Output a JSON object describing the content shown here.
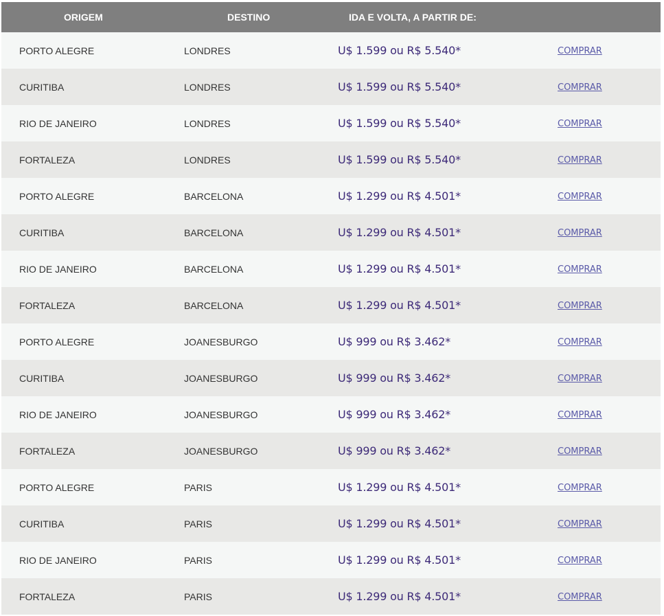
{
  "table": {
    "headers": {
      "origin": "ORIGEM",
      "destination": "DESTINO",
      "price": "IDA E VOLTA, A PARTIR DE:",
      "action": ""
    },
    "rows": [
      {
        "origin": "PORTO ALEGRE",
        "destination": "LONDRES",
        "price": "U$ 1.599 ou R$ 5.540*",
        "action": "COMPRAR"
      },
      {
        "origin": "CURITIBA",
        "destination": "LONDRES",
        "price": "U$ 1.599 ou R$ 5.540*",
        "action": "COMPRAR"
      },
      {
        "origin": "RIO DE JANEIRO",
        "destination": "LONDRES",
        "price": "U$ 1.599 ou R$ 5.540*",
        "action": "COMPRAR"
      },
      {
        "origin": "FORTALEZA",
        "destination": "LONDRES",
        "price": "U$ 1.599 ou R$ 5.540*",
        "action": "COMPRAR"
      },
      {
        "origin": "PORTO ALEGRE",
        "destination": "BARCELONA",
        "price": "U$ 1.299 ou R$ 4.501*",
        "action": "COMPRAR"
      },
      {
        "origin": "CURITIBA",
        "destination": "BARCELONA",
        "price": "U$ 1.299 ou R$ 4.501*",
        "action": "COMPRAR"
      },
      {
        "origin": "RIO DE JANEIRO",
        "destination": "BARCELONA",
        "price": "U$ 1.299 ou R$ 4.501*",
        "action": "COMPRAR"
      },
      {
        "origin": "FORTALEZA",
        "destination": "BARCELONA",
        "price": "U$ 1.299 ou R$ 4.501*",
        "action": "COMPRAR"
      },
      {
        "origin": "PORTO ALEGRE",
        "destination": "JOANESBURGO",
        "price": "U$ 999 ou R$ 3.462*",
        "action": "COMPRAR"
      },
      {
        "origin": "CURITIBA",
        "destination": "JOANESBURGO",
        "price": "U$ 999 ou R$ 3.462*",
        "action": "COMPRAR"
      },
      {
        "origin": "RIO DE JANEIRO",
        "destination": "JOANESBURGO",
        "price": "U$ 999 ou R$ 3.462*",
        "action": "COMPRAR"
      },
      {
        "origin": "FORTALEZA",
        "destination": "JOANESBURGO",
        "price": "U$ 999 ou R$ 3.462*",
        "action": "COMPRAR"
      },
      {
        "origin": "PORTO ALEGRE",
        "destination": "PARIS",
        "price": "U$ 1.299 ou R$ 4.501*",
        "action": "COMPRAR"
      },
      {
        "origin": "CURITIBA",
        "destination": "PARIS",
        "price": "U$ 1.299 ou R$ 4.501*",
        "action": "COMPRAR"
      },
      {
        "origin": "RIO DE JANEIRO",
        "destination": "PARIS",
        "price": "U$ 1.299 ou R$ 4.501*",
        "action": "COMPRAR"
      },
      {
        "origin": "FORTALEZA",
        "destination": "PARIS",
        "price": "U$ 1.299 ou R$ 4.501*",
        "action": "COMPRAR"
      }
    ]
  },
  "colors": {
    "header_bg": "#7f7f7f",
    "row_light": "#f5f7f6",
    "row_dark": "#e8e8e6",
    "price_text": "#3d2a78",
    "link_text": "#5a5aa8"
  }
}
